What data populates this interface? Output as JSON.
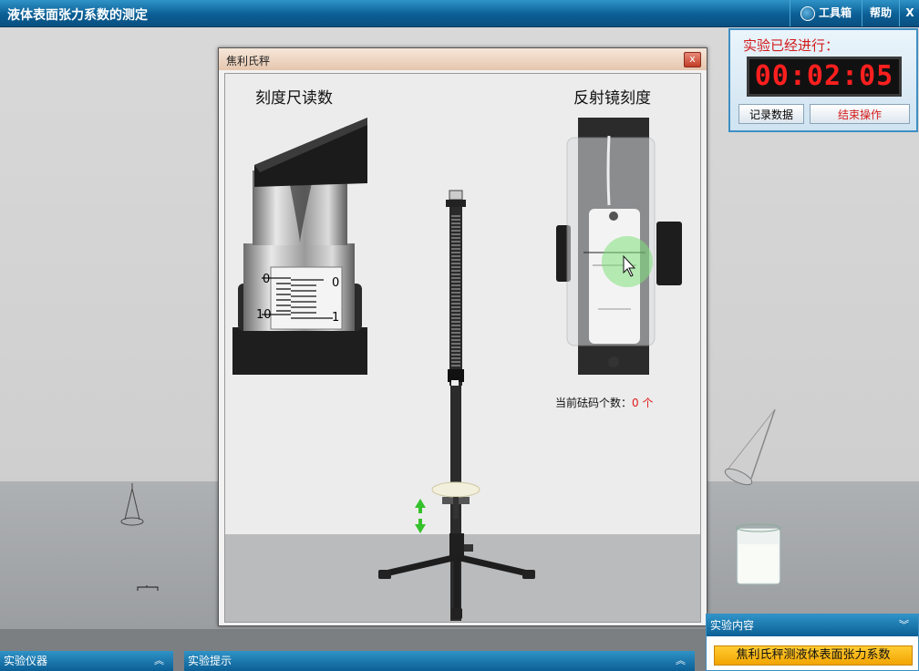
{
  "app": {
    "title": "液体表面张力系数的测定",
    "toolbox_label": "工具箱",
    "help_label": "帮助",
    "close_label": "X"
  },
  "timer": {
    "label": "实验已经进行：",
    "value": "00:02:05",
    "record_button": "记录数据",
    "end_button": "结束操作"
  },
  "dialog": {
    "title": "焦利氏秤",
    "close_label": "x",
    "scale_heading": "刻度尺读数",
    "mirror_heading": "反射镜刻度",
    "scale_labels": {
      "left_top": "0",
      "left_bottom": "10",
      "right_top": "0",
      "right_bottom": "1"
    },
    "weights_label": "当前砝码个数：",
    "weights_value": "0 个"
  },
  "bottom": {
    "instruments": "实验仪器",
    "hints": "实验提示",
    "content_title": "实验内容",
    "content_item": "焦利氏秤测液体表面张力系数"
  },
  "colors": {
    "title_bar": "#0b5f95",
    "timer_digits": "#ff1f1f",
    "accent_orange": "#f2a400",
    "warning_red": "#e01b1b"
  }
}
